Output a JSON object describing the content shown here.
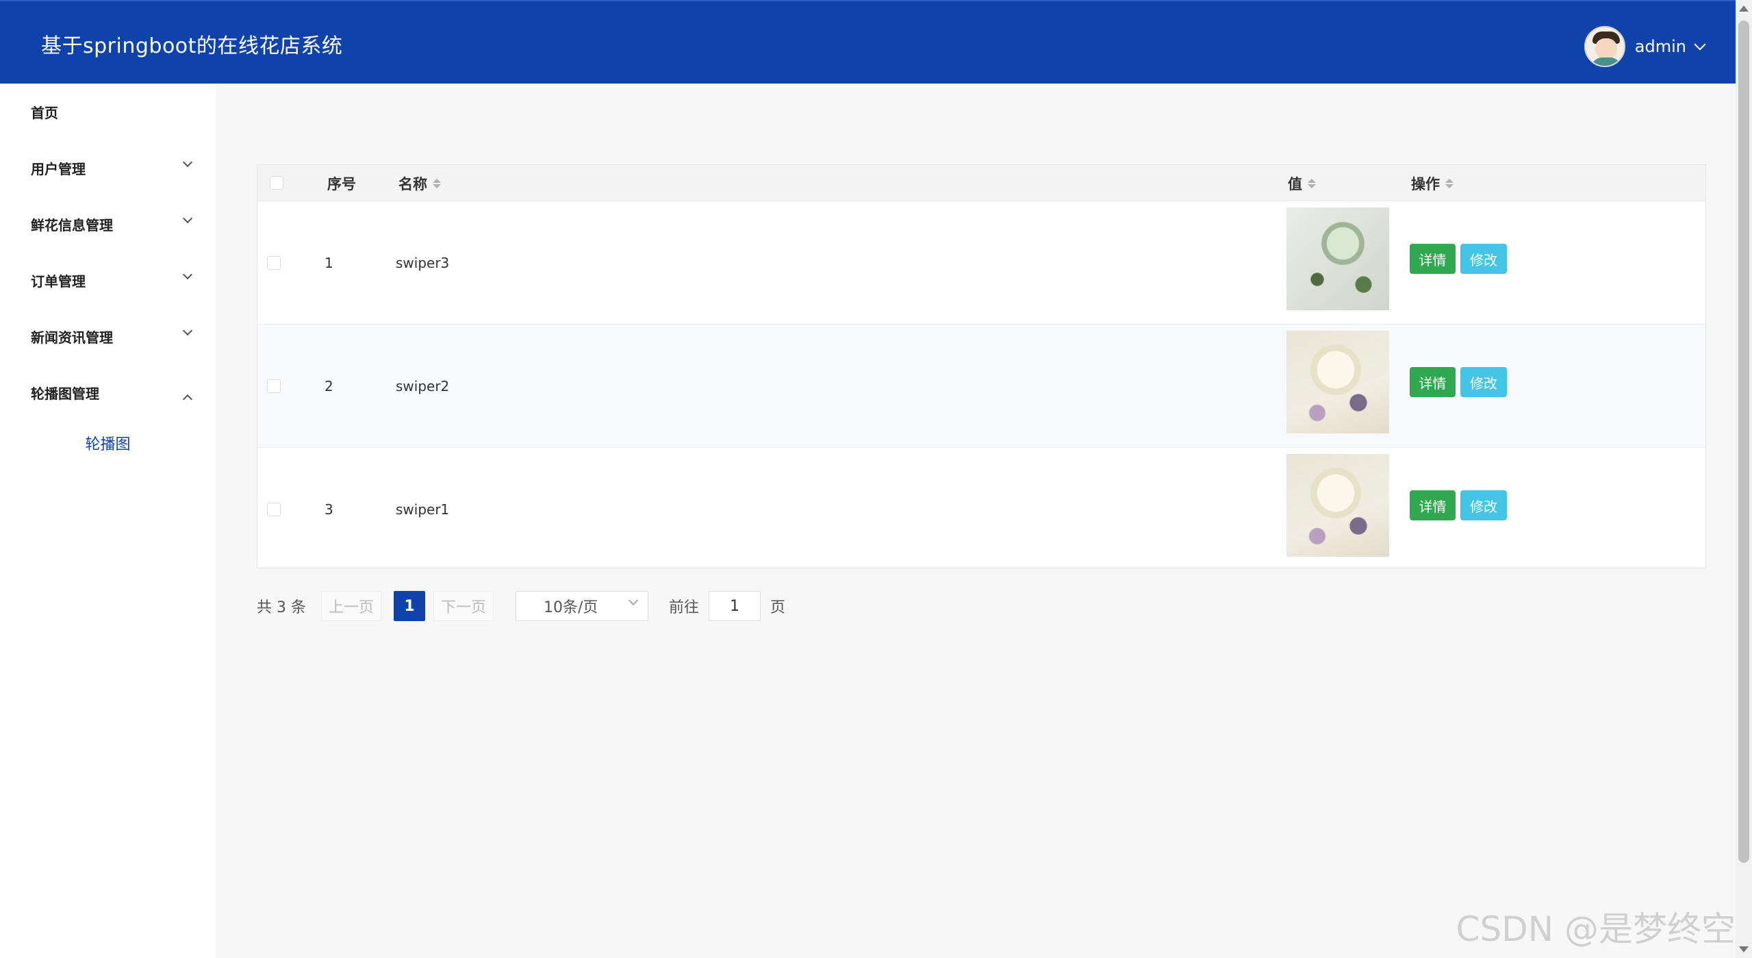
{
  "header": {
    "app_title": "基于springboot的在线花店系统",
    "user_name": "admin"
  },
  "sidebar": {
    "items": [
      {
        "label": "首页",
        "has_children": false
      },
      {
        "label": "用户管理",
        "has_children": true,
        "expanded": false
      },
      {
        "label": "鲜花信息管理",
        "has_children": true,
        "expanded": false
      },
      {
        "label": "订单管理",
        "has_children": true,
        "expanded": false
      },
      {
        "label": "新闻资讯管理",
        "has_children": true,
        "expanded": false
      },
      {
        "label": "轮播图管理",
        "has_children": true,
        "expanded": true
      }
    ],
    "active_sub_item": "轮播图"
  },
  "table": {
    "columns": [
      "序号",
      "名称",
      "值",
      "操作"
    ],
    "rows": [
      {
        "index": "1",
        "name": "swiper3",
        "image": "flower-green"
      },
      {
        "index": "2",
        "name": "swiper2",
        "image": "flower-white"
      },
      {
        "index": "3",
        "name": "swiper1",
        "image": "flower-white"
      }
    ],
    "actions": {
      "detail": "详情",
      "edit": "修改"
    }
  },
  "pagination": {
    "total": "共 3 条",
    "prev": "上一页",
    "current_page": "1",
    "next": "下一页",
    "page_size": "10条/页",
    "goto_label": "前往",
    "goto_value": "1",
    "page_suffix": "页"
  },
  "watermark": "CSDN @是梦终空",
  "colors": {
    "header_bg": "#0f43ab",
    "detail_btn": "#2fa84f",
    "edit_btn": "#44c5e6",
    "active_text": "#0f43ab"
  }
}
